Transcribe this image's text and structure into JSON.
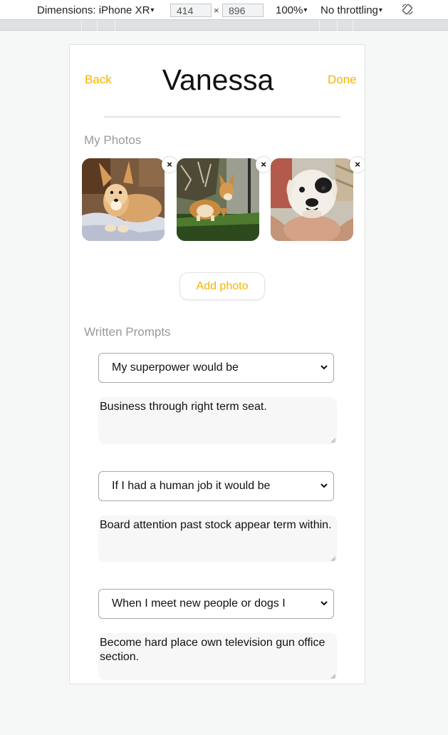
{
  "devtools": {
    "device_label": "Dimensions: iPhone XR",
    "width_value": "414",
    "height_value": "896",
    "times": "×",
    "zoom": "100%",
    "throttling": "No throttling",
    "rotate_icon": "rotate-icon",
    "caret": "▾"
  },
  "header": {
    "back_label": "Back",
    "title": "Vanessa",
    "done_label": "Done"
  },
  "photos": {
    "section_label": "My Photos",
    "remove_glyph": "×",
    "items": [
      {
        "alt": "corgi lying on a blanket"
      },
      {
        "alt": "corgi standing on grass"
      },
      {
        "alt": "bulldog puppy held in hand"
      }
    ],
    "add_label": "Add photo"
  },
  "prompts": {
    "section_label": "Written Prompts",
    "items": [
      {
        "question": "My superpower would be",
        "answer": "Business through right term seat."
      },
      {
        "question": "If I had a human job it would be",
        "answer": "Board attention past stock appear term within."
      },
      {
        "question": "When I meet new people or dogs I",
        "answer": "Become hard place own television gun office section."
      }
    ]
  },
  "colors": {
    "accent": "#f5b400",
    "muted_label": "#9a9a9a"
  }
}
